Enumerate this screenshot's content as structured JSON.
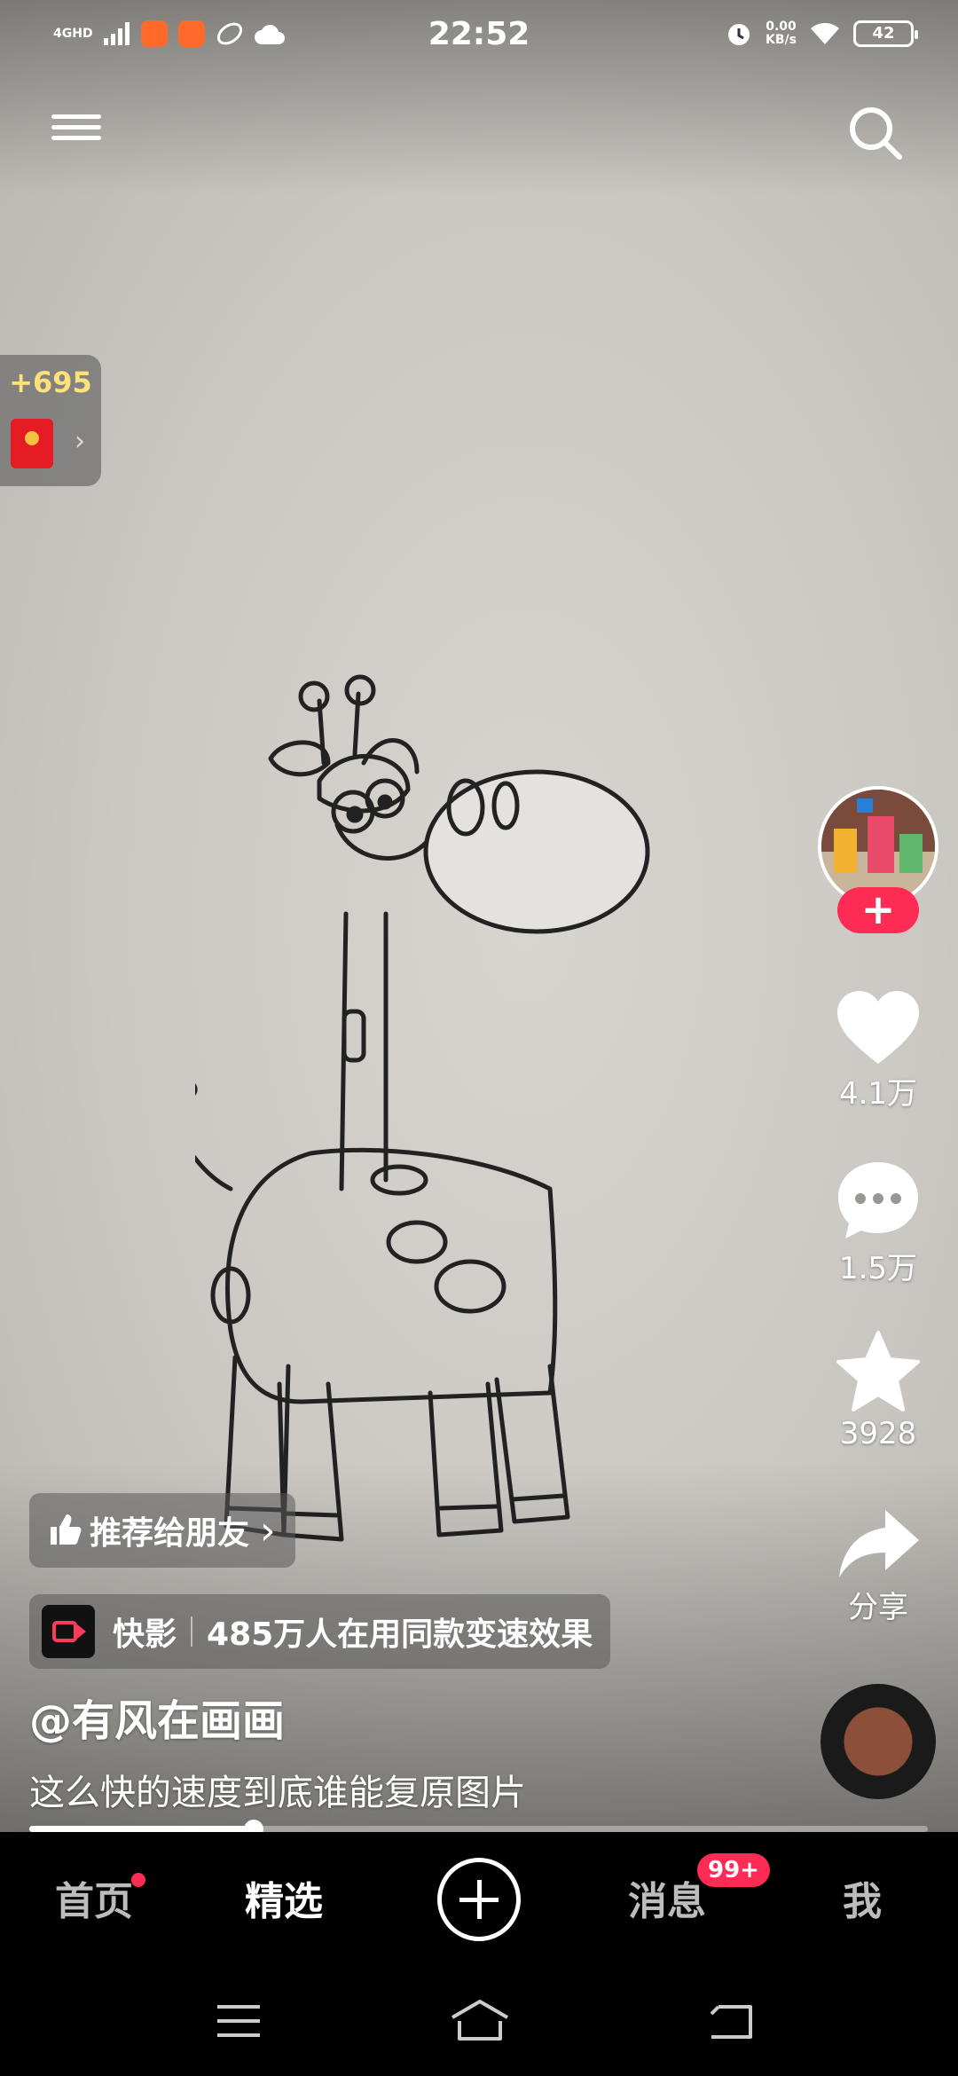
{
  "status_bar": {
    "time": "22:52",
    "network": "4GHD",
    "speed_value": "0.00",
    "speed_unit": "KB/s",
    "battery": "42"
  },
  "reward": {
    "amount": "+695",
    "icon": "red-envelope-icon"
  },
  "actions": {
    "like_count": "4.1万",
    "comment_count": "1.5万",
    "favorite_count": "3928",
    "share_label": "分享",
    "follow_label": "+"
  },
  "recommend_chip": {
    "label": "推荐给朋友",
    "chevron": "›"
  },
  "effect_chip": {
    "app_name": "快影",
    "text": "485万人在用同款变速效果"
  },
  "video": {
    "author": "@有风在画画",
    "caption": "这么快的速度到底谁能复原图片",
    "progress": 0.25
  },
  "tabs": [
    {
      "label": "首页",
      "active": false,
      "dot": true
    },
    {
      "label": "精选",
      "active": true
    },
    {
      "label": "消息",
      "active": false,
      "badge": "99+"
    },
    {
      "label": "我",
      "active": false
    }
  ],
  "colors": {
    "accent": "#fe2c55",
    "reward_text": "#ffe17a",
    "tab_bar": "#000000"
  }
}
